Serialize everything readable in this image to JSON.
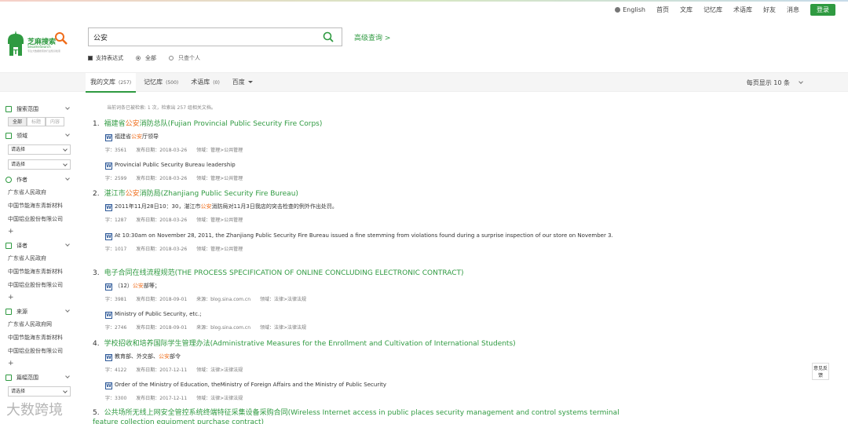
{
  "topnav": {
    "lang": "English",
    "items": [
      "首页",
      "文库",
      "记忆库",
      "术语库",
      "好友",
      "消息"
    ],
    "login": "登录"
  },
  "logo": {
    "text": "芝麻搜索",
    "sub": "SesameSearch",
    "tiny": "专注大数据搜索的行业知识检索"
  },
  "search": {
    "query": "公安",
    "advanced": "高级查询 >"
  },
  "options": {
    "regex": "支持表达式",
    "all": "全部",
    "personal": "只查个人"
  },
  "tabs": [
    {
      "label": "我的文库",
      "count": "(257)"
    },
    {
      "label": "记忆库",
      "count": "(500)"
    },
    {
      "label": "术语库",
      "count": "(0)"
    },
    {
      "label": "百度",
      "count": ""
    }
  ],
  "per_page": "每页显示 10 条",
  "sidebar": {
    "scope": {
      "title": "搜索范围",
      "segs": [
        "全部",
        "标题",
        "内容"
      ]
    },
    "domain": {
      "title": "领域",
      "select1": "请选择",
      "select2": "请选择"
    },
    "author": {
      "title": "作者",
      "items": [
        "广东省人民政府",
        "中国节能海东青新材料",
        "中国铝业股份有限公司"
      ]
    },
    "translator": {
      "title": "译者",
      "items": [
        "广东省人民政府",
        "中国节能海东青新材料",
        "中国铝业股份有限公司"
      ]
    },
    "source": {
      "title": "来源",
      "items": [
        "广东省人民政府网",
        "中国节能海东青新材料",
        "中国铝业股份有限公司"
      ]
    },
    "length": {
      "title": "篇幅范围",
      "select": "请选择"
    },
    "plus": "+"
  },
  "summary": "当前词条已被检索: 1 次，检索出 257 组相关文档。",
  "results": [
    {
      "num": "1.",
      "title_pre": "福建省",
      "title_hl": "公安",
      "title_post": "消防总队(Fujian Provincial Public Security Fire Corps)",
      "zh_pre": "福建省",
      "zh_hl": "公安",
      "zh_post": "厅领导",
      "zh_meta": [
        "字：3561",
        "发布日期：2018-03-26",
        "领域：管理>公共管理"
      ],
      "en": "Provincial Public Security Bureau leadership",
      "en_meta": [
        "字：2599",
        "发布日期：2018-03-26",
        "领域：管理>公共管理"
      ]
    },
    {
      "num": "2.",
      "title_pre": "湛江市",
      "title_hl": "公安",
      "title_post": "消防局(Zhanjiang Public Security Fire Bureau)",
      "zh_pre": "2011年11月28日10：30，湛江市",
      "zh_hl": "公安",
      "zh_post": "消防局对11月3日我店的突击检查的例外作出处罚。",
      "zh_meta": [
        "字：1287",
        "发布日期：2018-03-26",
        "领域：管理>公共管理"
      ],
      "en": "At 10:30am on November 28, 2011, the Zhanjiang Public Security Fire Bureau issued a fine stemming from violations found during a surprise inspection of our store on November 3.",
      "en_meta": [
        "字：1017",
        "发布日期：2018-03-26",
        "领域：管理>公共管理"
      ]
    },
    {
      "num": "3.",
      "title_pre": "",
      "title_hl": "",
      "title_post": "电子合同在线流程规范(THE PROCESS SPECIFICATION OF ONLINE CONCLUDING ELECTRONIC CONTRACT)",
      "zh_pre": "（12）",
      "zh_hl": "公安",
      "zh_post": "部等；",
      "zh_meta": [
        "字：3981",
        "发布日期：2018-09-01",
        "来源：blog.sina.com.cn",
        "领域：法律>法律法规"
      ],
      "en": "Ministry of Public Security, etc.;",
      "en_meta": [
        "字：2746",
        "发布日期：2018-09-01",
        "来源：blog.sina.com.cn",
        "领域：法律>法律法规"
      ]
    },
    {
      "num": "4.",
      "title_pre": "",
      "title_hl": "",
      "title_post": "学校招收和培养国际学生管理办法(Administrative Measures for the Enrollment and Cultivation of International Students)",
      "zh_pre": "教育部、外交部、",
      "zh_hl": "公安",
      "zh_post": "部令",
      "zh_meta": [
        "字：4122",
        "发布日期：2017-12-11",
        "领域：法律>法律法规"
      ],
      "en": "Order of the Ministry of Education, theMinistry of Foreign Affairs and the Ministry of Public Security",
      "en_meta": [
        "字：3300",
        "发布日期：2017-12-11",
        "领域：法律>法律法规"
      ]
    },
    {
      "num": "5.",
      "title_pre": "",
      "title_hl": "",
      "title_post": "公共场所无线上网安全管控系统终端特征采集设备采购合同(Wireless Internet access in public places security management and control systems terminal feature collection equipment purchase contract)"
    }
  ],
  "feedback": "意见反馈",
  "watermark": "大数跨境"
}
